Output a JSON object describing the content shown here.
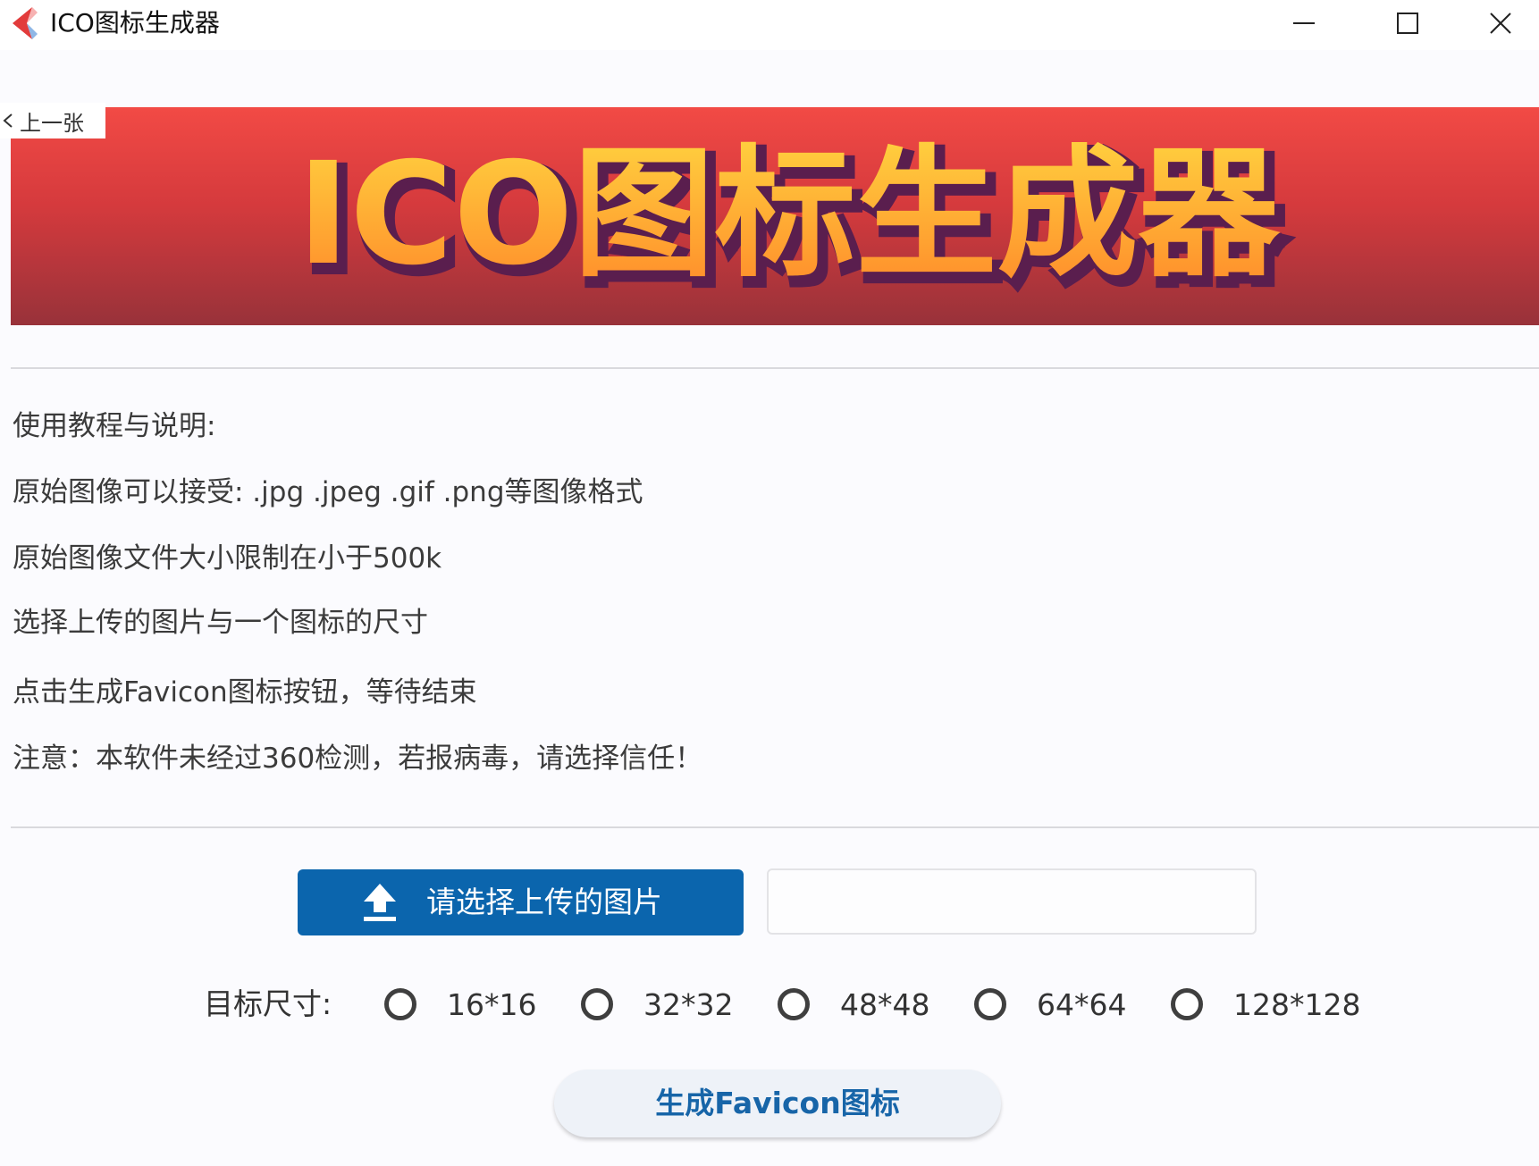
{
  "window": {
    "title": "ICO图标生成器",
    "controls": [
      "minimize-icon",
      "maximize-icon",
      "close-icon"
    ]
  },
  "banner": {
    "title": "ICO图标生成器",
    "prev_label": "上一张",
    "colors": {
      "background_top": "#f24a45",
      "background_bottom": "#98323a",
      "text_top": "#ffd23f",
      "text_bottom": "#ff8a2a",
      "text_shadow": "#5a1e4e"
    }
  },
  "instructions": {
    "heading": "使用教程与说明:",
    "lines": [
      "原始图像可以接受: .jpg .jpeg .gif .png等图像格式",
      "原始图像文件大小限制在小于500k",
      "选择上传的图片与一个图标的尺寸",
      "点击生成Favicon图标按钮，等待结束",
      "注意：本软件未经过360检测，若报病毒，请选择信任！"
    ]
  },
  "upload": {
    "button_label": "请选择上传的图片",
    "icon": "upload-icon",
    "file_value": "",
    "accent": "#0b65ad"
  },
  "size": {
    "label": "目标尺寸:",
    "options": [
      "16*16",
      "32*32",
      "48*48",
      "64*64",
      "128*128"
    ],
    "selected": null
  },
  "generate": {
    "label": "生成Favicon图标"
  }
}
